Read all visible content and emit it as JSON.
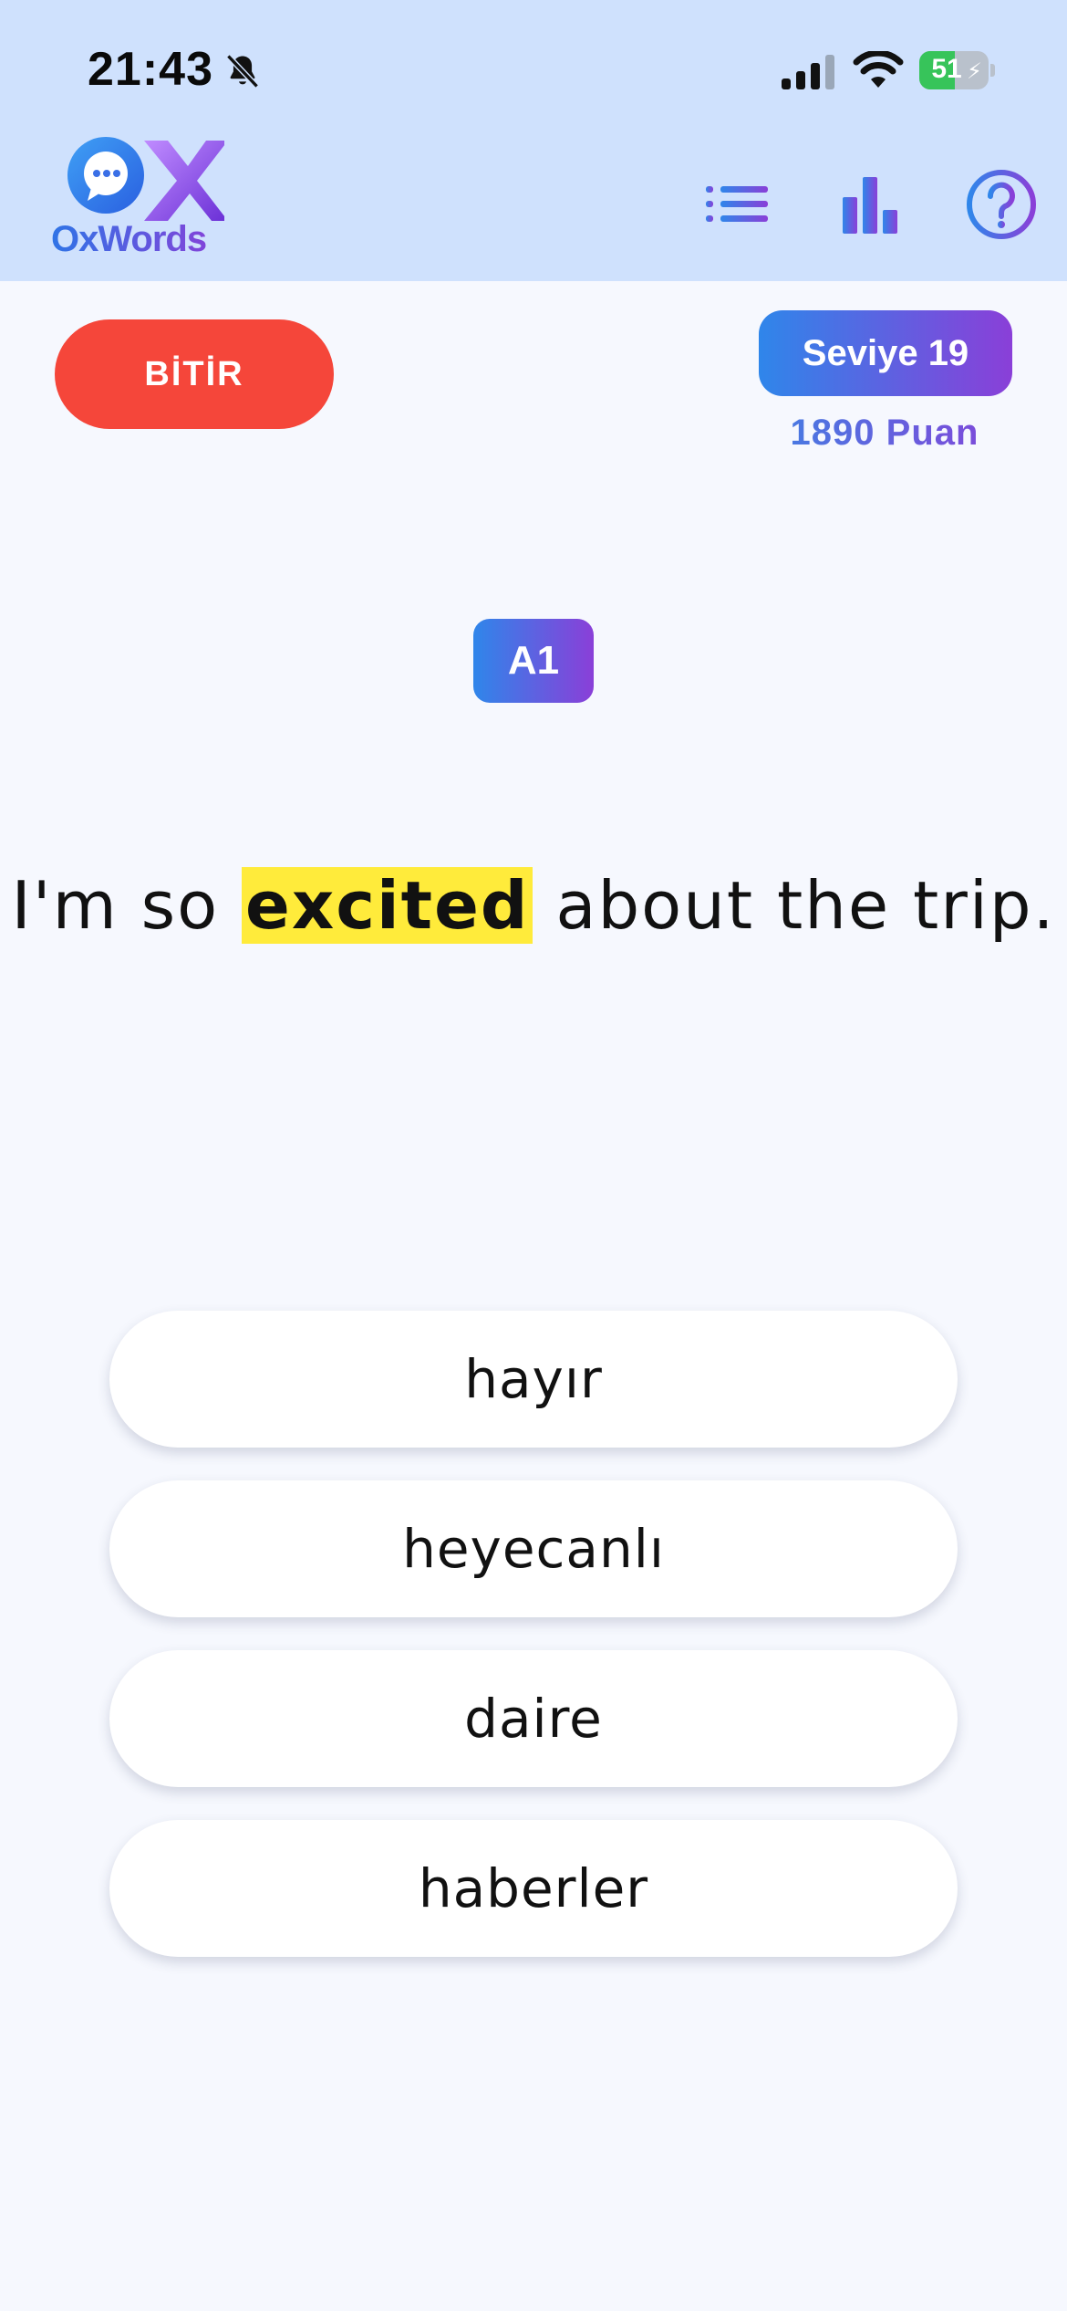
{
  "status_bar": {
    "time": "21:43",
    "battery_percent": "51",
    "battery_level": 0.51,
    "icons": [
      "bell-slash-icon",
      "cellular-signal-icon",
      "wifi-icon",
      "battery-charging-icon"
    ]
  },
  "header": {
    "brand": "OxWords",
    "nav_icons": [
      "list-icon",
      "bar-chart-icon",
      "help-icon"
    ]
  },
  "session": {
    "finish_label": "BİTİR",
    "level_label": "Seviye 19",
    "points_label": "1890 Puan"
  },
  "question": {
    "cefr_level": "A1",
    "sentence_before": "I'm so ",
    "target_word": "excited",
    "sentence_after": " about the trip."
  },
  "options": [
    {
      "label": "hayır"
    },
    {
      "label": "heyecanlı"
    },
    {
      "label": "daire"
    },
    {
      "label": "haberler"
    }
  ],
  "colors": {
    "header_bg": "#cfe1fd",
    "page_bg": "#f6f8fe",
    "finish_red": "#f5463a",
    "gradient_start": "#2f86ea",
    "gradient_end": "#8a3fd8",
    "highlight_yellow": "#ffeb3b"
  }
}
